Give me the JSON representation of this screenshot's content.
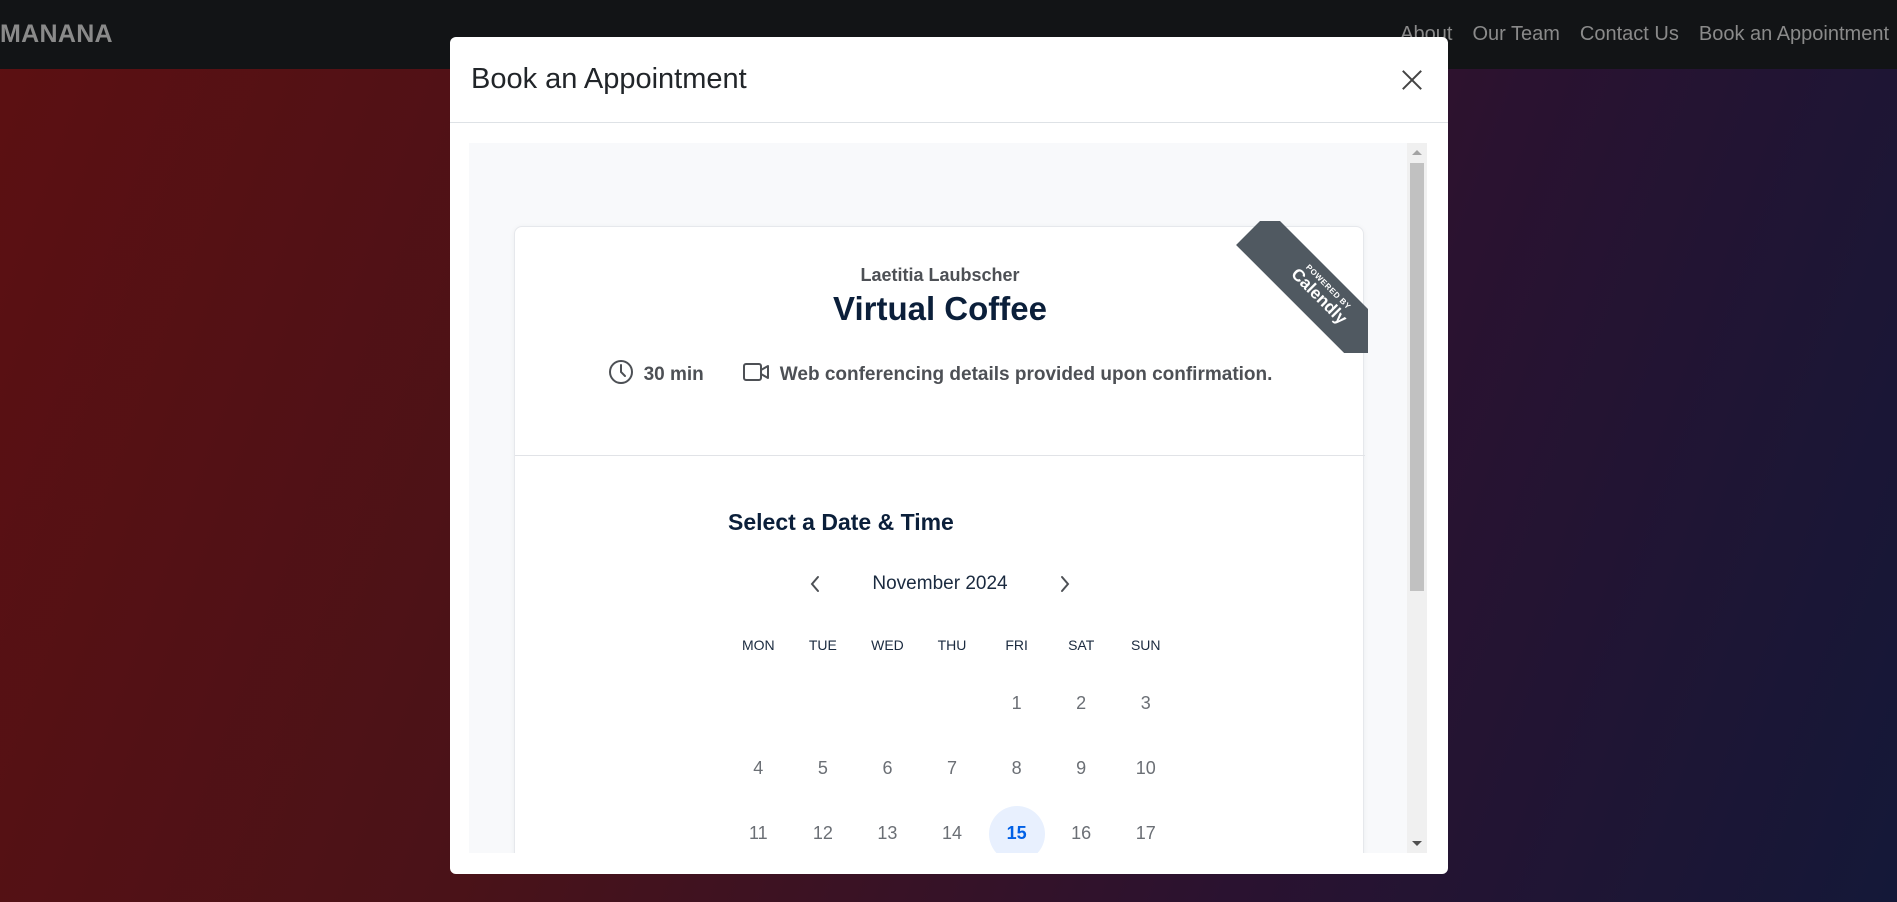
{
  "navbar": {
    "brand": "MANANA",
    "links": [
      "About",
      "Our Team",
      "Contact Us",
      "Book an Appointment"
    ]
  },
  "modal": {
    "title": "Book an Appointment"
  },
  "calendly": {
    "ribbon_top": "POWERED BY",
    "ribbon_brand": "Calendly",
    "organizer": "Laetitia Laubscher",
    "event_name": "Virtual Coffee",
    "duration": "30 min",
    "location": "Web conferencing details provided upon confirmation.",
    "select_title": "Select a Date & Time",
    "month": "November 2024",
    "weekdays": [
      "MON",
      "TUE",
      "WED",
      "THU",
      "FRI",
      "SAT",
      "SUN"
    ],
    "weeks": [
      [
        "",
        "",
        "",
        "",
        "1",
        "2",
        "3"
      ],
      [
        "4",
        "5",
        "6",
        "7",
        "8",
        "9",
        "10"
      ],
      [
        "11",
        "12",
        "13",
        "14",
        "15",
        "16",
        "17"
      ]
    ],
    "selected_day": "15",
    "today": "11"
  },
  "colors": {
    "accent": "#0060e6",
    "selected_bg": "#e8f0fe",
    "title": "#0b1f3a",
    "ribbon": "#505961"
  }
}
